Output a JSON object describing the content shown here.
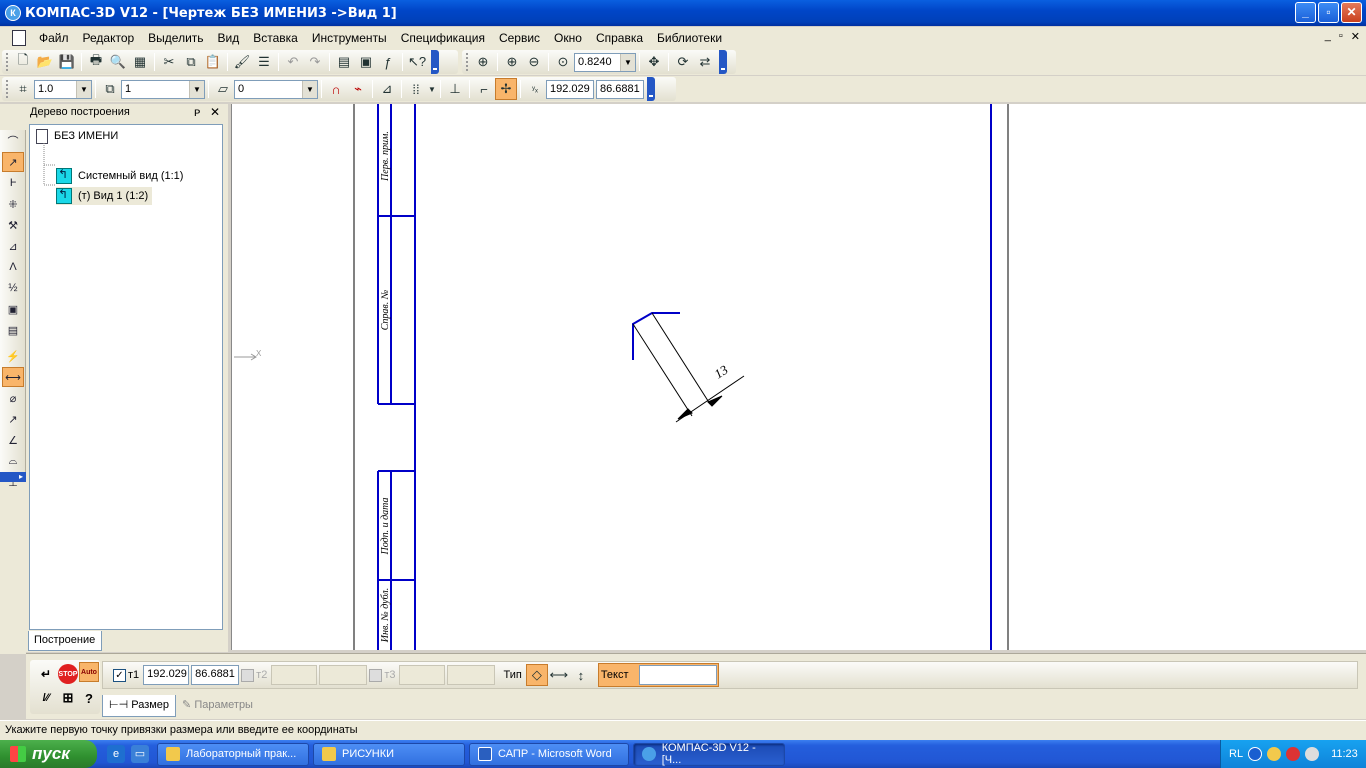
{
  "window": {
    "title": "КОМПАС-3D V12 - [Чертеж БЕЗ ИМЕНИ3 ->Вид 1]",
    "icon": "К",
    "minimize": "_",
    "maximize": "▫",
    "close": "✕"
  },
  "menu": {
    "items": [
      "Файл",
      "Редактор",
      "Выделить",
      "Вид",
      "Вставка",
      "Инструменты",
      "Спецификация",
      "Сервис",
      "Окно",
      "Справка",
      "Библиотеки"
    ],
    "mdi_min": "_",
    "mdi_restore": "▫",
    "mdi_close": "✕"
  },
  "toolbar": {
    "zoom_value": "0.8240",
    "scale_value": "1.0",
    "layer_value": "1",
    "style_value": "0",
    "cursor_x": "192.029",
    "cursor_y": "86.6881"
  },
  "tree": {
    "header": "Дерево построения",
    "pin": "ᴘ",
    "close": "✕",
    "root": "БЕЗ ИМЕНИ",
    "nodes": [
      "Системный вид (1:1)",
      "(т) Вид 1 (1:2)"
    ],
    "tab": "Построение"
  },
  "drawing": {
    "dimension_value": "13",
    "stamp_labels": [
      "Перв. прим.",
      "Справ. №",
      "Подп. и дата",
      "Инв. № дубл."
    ],
    "axis_label": "X",
    "line_color": "#0000c8"
  },
  "propbar": {
    "t1_label": "т1",
    "t1_x": "192.029",
    "t1_y": "86.6881",
    "t2_label": "т2",
    "t3_label": "т3",
    "type_label": "Тип",
    "text_label": "Текст",
    "text_value": "",
    "tabs": [
      "Размер",
      "Параметры"
    ]
  },
  "status": {
    "text": "Укажите первую точку привязки размера или введите ее координаты"
  },
  "taskbar": {
    "start": "пуск",
    "tasks": [
      "Лабораторный прак...",
      "РИСУНКИ",
      "САПР - Microsoft Word",
      "КОМПАС-3D V12 - [Ч..."
    ],
    "lang": "RL",
    "clock": "11:23"
  }
}
